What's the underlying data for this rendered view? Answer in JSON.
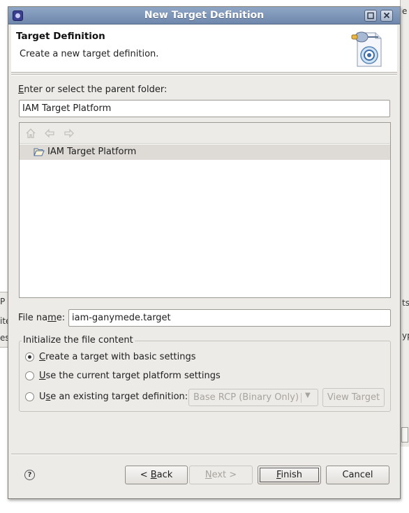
{
  "window": {
    "title": "New Target Definition"
  },
  "background": {
    "right_fragments": [
      "e i",
      "ts",
      "yp"
    ],
    "left_fragments": [
      "P",
      "ite",
      "es"
    ]
  },
  "header": {
    "title": "Target Definition",
    "description": "Create a new target definition."
  },
  "parent_folder": {
    "label_prefix": "",
    "label_mnemonic": "E",
    "label_rest": "nter or select the parent folder:",
    "value": "IAM Target Platform"
  },
  "tree": {
    "toolbar_icons": [
      "home-icon",
      "back-arrow-icon",
      "forward-arrow-icon"
    ],
    "items": [
      {
        "label": "IAM Target Platform",
        "icon": "open-folder-icon",
        "selected": true
      }
    ]
  },
  "file_name": {
    "label_prefix": "File na",
    "label_mnemonic": "m",
    "label_rest": "e:",
    "value": "iam-ganymede.target"
  },
  "init_group": {
    "title": "Initialize the file content",
    "options": [
      {
        "mnemonic": "C",
        "rest": "reate a target with basic settings",
        "selected": true
      },
      {
        "mnemonic": "U",
        "rest": "se the current target platform settings",
        "selected": false
      },
      {
        "prefix": "U",
        "mnemonic": "s",
        "rest": "e an existing target definition:",
        "selected": false
      }
    ],
    "existing_combo": {
      "value": "Base RCP (Binary Only)",
      "enabled": false
    },
    "view_target_button": {
      "label": "View Target",
      "enabled": false
    }
  },
  "buttons": {
    "back": {
      "prefix": "< ",
      "mnemonic": "B",
      "rest": "ack",
      "enabled": true
    },
    "next": {
      "prefix": "",
      "mnemonic": "N",
      "rest": "ext >",
      "enabled": false
    },
    "finish": {
      "prefix": "",
      "mnemonic": "F",
      "rest": "inish",
      "enabled": true
    },
    "cancel": {
      "label": "Cancel",
      "enabled": true
    }
  },
  "help": {
    "icon": "help-icon",
    "symbol": "?"
  },
  "colors": {
    "dialog_bg": "#edebe8",
    "titlebar": "#6e87ab",
    "selection_row": "#dedbd7",
    "disabled_text": "#a7a39d"
  }
}
